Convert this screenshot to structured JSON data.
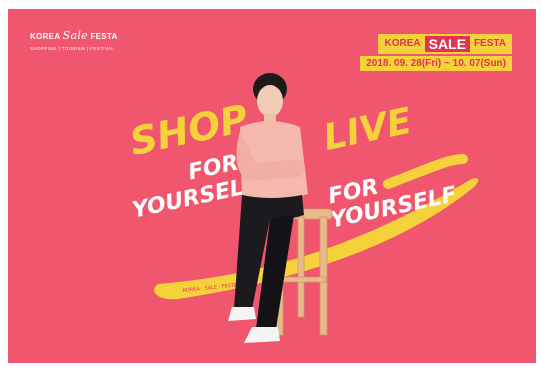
{
  "logo": {
    "korea": "KOREA",
    "sale": "Sale",
    "festa": "FESTA",
    "subtitle": "SHOPPING | TOURISM | FESTIVAL"
  },
  "banner": {
    "korea": "KOREA",
    "sale": "SALE",
    "festa": "FESTA",
    "dates": "2018. 09. 28(Fri) ~ 10. 07(Sun)"
  },
  "slogan": {
    "shop": "SHOP",
    "for_left": "FOR",
    "yourself_left": "YOURSELF",
    "live": "LIVE",
    "for_right": "FOR",
    "yourself_right": "YOURSELF"
  },
  "colors": {
    "background": "#f0566e",
    "accent_yellow": "#f5d23b",
    "accent_red": "#e0344f",
    "text_white": "#ffffff"
  }
}
